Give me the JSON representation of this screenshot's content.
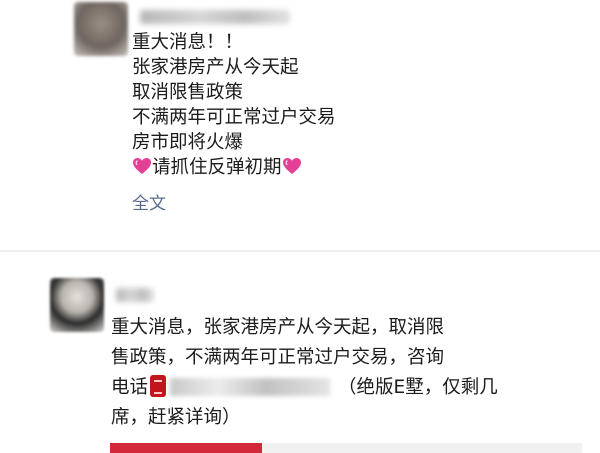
{
  "post1": {
    "lines": [
      "重大消息！！",
      "张家港房产从今天起",
      "取消限售政策",
      "不满两年可正常过户交易",
      "房市即将火爆"
    ],
    "last_line": "请抓住反弹初期",
    "full_text_link": "全文",
    "heart_color": "#e33f95"
  },
  "post2": {
    "row1": "重大消息，张家港房产从今天起，取消限",
    "row2": "售政策，不满两年可正常过户交易，咨询",
    "row3_prefix": "电话",
    "row3_suffix": "（绝版E墅，仅剩几",
    "row4": "席，赶紧详询）",
    "accent_color": "#d3283a"
  }
}
